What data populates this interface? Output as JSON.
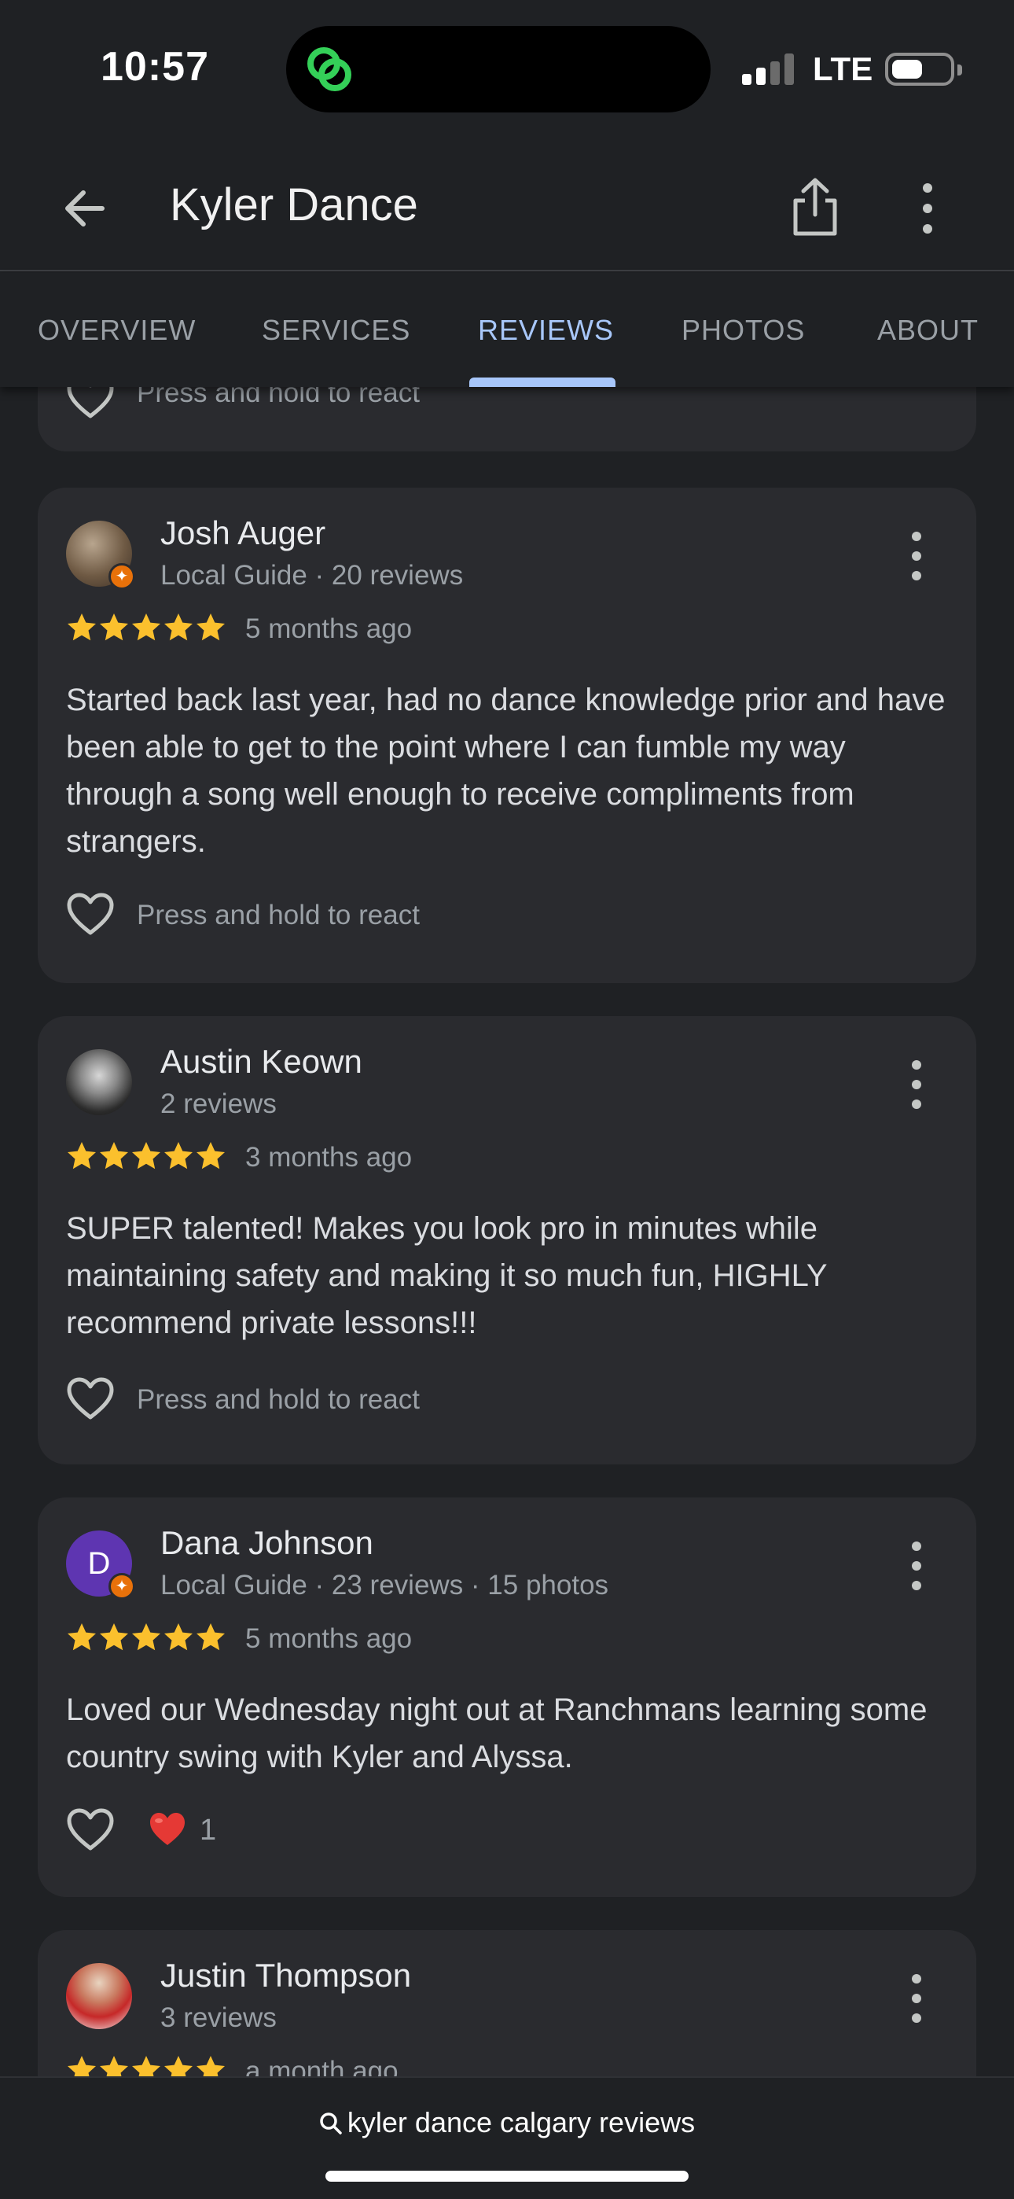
{
  "status_bar": {
    "time": "10:57",
    "network": "LTE",
    "signal_bars": 2,
    "battery_level": 0.45
  },
  "header": {
    "title": "Kyler Dance"
  },
  "tabs": [
    {
      "label": "OVERVIEW",
      "active": false
    },
    {
      "label": "SERVICES",
      "active": false
    },
    {
      "label": "REVIEWS",
      "active": true
    },
    {
      "label": "PHOTOS",
      "active": false
    },
    {
      "label": "ABOUT",
      "active": false
    }
  ],
  "partial_card": {
    "react_label": "Press and hold to react"
  },
  "reviews": [
    {
      "name": "Josh Auger",
      "meta": "Local Guide · 20 reviews",
      "local_guide": true,
      "rating": 5,
      "time_ago": "5 months ago",
      "text": "Started back last year, had no dance knowledge prior and have been able to get to the point where I can fumble my way through a song well enough to receive compliments from strangers.",
      "react_label": "Press and hold to react"
    },
    {
      "name": "Austin Keown",
      "meta": "2 reviews",
      "local_guide": false,
      "rating": 5,
      "time_ago": "3 months ago",
      "text": "SUPER talented! Makes you look pro in minutes while maintaining safety and making it so much fun, HIGHLY recommend private lessons!!!",
      "react_label": "Press and hold to react"
    },
    {
      "name": "Dana Johnson",
      "avatar_initial": "D",
      "meta": "Local Guide · 23 reviews · 15 photos",
      "local_guide": true,
      "rating": 5,
      "time_ago": "5 months ago",
      "text": "Loved our Wednesday night out at Ranchmans learning some country swing with Kyler and Alyssa.",
      "reaction_count": "1"
    },
    {
      "name": "Justin Thompson",
      "meta": "3 reviews",
      "local_guide": false,
      "rating": 5,
      "time_ago": "a month ago"
    }
  ],
  "bottom_bar": {
    "search_query": "kyler dance calgary reviews"
  },
  "colors": {
    "background": "#1f2124",
    "card": "#2a2b2f",
    "accent": "#a8c7fa",
    "star": "#fbc02d",
    "heart": "#e53935",
    "local_guide_badge": "#e8710a"
  }
}
